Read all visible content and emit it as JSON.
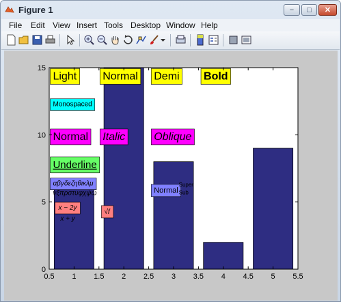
{
  "window": {
    "title": "Figure 1",
    "buttons": {
      "minimize": "−",
      "maximize": "□",
      "close": "✕"
    }
  },
  "menu": [
    "File",
    "Edit",
    "View",
    "Insert",
    "Tools",
    "Desktop",
    "Window",
    "Help"
  ],
  "toolbar_icons": [
    "new-figure-icon",
    "open-file-icon",
    "save-icon",
    "print-icon",
    "edit-plot-arrow-icon",
    "zoom-in-icon",
    "zoom-out-icon",
    "pan-hand-icon",
    "rotate-3d-icon",
    "data-cursor-icon",
    "brush-icon",
    "brush-dropdown-icon",
    "link-plot-icon",
    "insert-colorbar-icon",
    "insert-legend-icon",
    "hide-plot-tools-icon",
    "show-plot-tools-icon"
  ],
  "chart_data": {
    "type": "bar",
    "x": [
      1,
      2,
      3,
      4,
      5
    ],
    "values": [
      6.5,
      15,
      8,
      2,
      9
    ],
    "xlim": [
      0.5,
      5.5
    ],
    "ylim": [
      0,
      15
    ],
    "xticks": [
      "0.5",
      "1",
      "1.5",
      "2",
      "2.5",
      "3",
      "3.5",
      "4",
      "4.5",
      "5",
      "5.5"
    ],
    "yticks": [
      "0",
      "5",
      "10",
      "15"
    ],
    "bar_color": "#2e2d82",
    "grid": false,
    "annotations": [
      {
        "text": "Light",
        "style": "light",
        "bg": "#ffff00",
        "x": 0.52,
        "y": 14.4
      },
      {
        "text": "Normal",
        "style": "normal",
        "bg": "#ffff00",
        "x": 1.52,
        "y": 14.4
      },
      {
        "text": "Demi",
        "style": "demi",
        "bg": "#ffff00",
        "x": 2.55,
        "y": 14.4
      },
      {
        "text": "Bold",
        "style": "bold",
        "bg": "#ffff00",
        "x": 3.55,
        "y": 14.4
      },
      {
        "text": "Monospaced",
        "style": "mono",
        "bg": "#00ffff",
        "x": 0.52,
        "y": 12.3
      },
      {
        "text": "Normal",
        "style": "normal",
        "bg": "#ff00ff",
        "x": 0.52,
        "y": 9.9
      },
      {
        "text": "Italic",
        "style": "italic",
        "bg": "#ff00ff",
        "x": 1.52,
        "y": 9.9
      },
      {
        "text": "Oblique",
        "style": "italic",
        "bg": "#ff00ff",
        "x": 2.55,
        "y": 9.9
      },
      {
        "text": "Underline",
        "style": "serif",
        "bg": "#66ff66",
        "x": 0.52,
        "y": 7.8
      },
      {
        "text": "αβγδεζηθικλμ",
        "style": "serif-italic",
        "bg": "#8080ff",
        "x": 0.52,
        "y": 6.4
      },
      {
        "text": "νξπρστυφχψω",
        "style": "serif-italic",
        "bg": "none",
        "x": 0.52,
        "y": 5.7
      },
      {
        "text": "Normal",
        "style": "normal-small",
        "bg": "#8080ff",
        "x": 2.55,
        "y": 5.9
      },
      {
        "text": "Super",
        "style": "tiny",
        "bg": "none",
        "x": 3.05,
        "y": 6.3
      },
      {
        "text": "Sub",
        "style": "tiny",
        "bg": "none",
        "x": 3.05,
        "y": 5.7
      },
      {
        "text": "x − 2y",
        "style": "serif-italic-small",
        "bg": "#ff7f7f",
        "x": 0.63,
        "y": 4.6
      },
      {
        "text": "x + y",
        "style": "serif-italic-small",
        "bg": "none",
        "x": 0.67,
        "y": 3.8
      },
      {
        "text": "√f",
        "style": "serif-italic-small",
        "bg": "#ff7f7f",
        "x": 1.55,
        "y": 4.3
      }
    ]
  }
}
